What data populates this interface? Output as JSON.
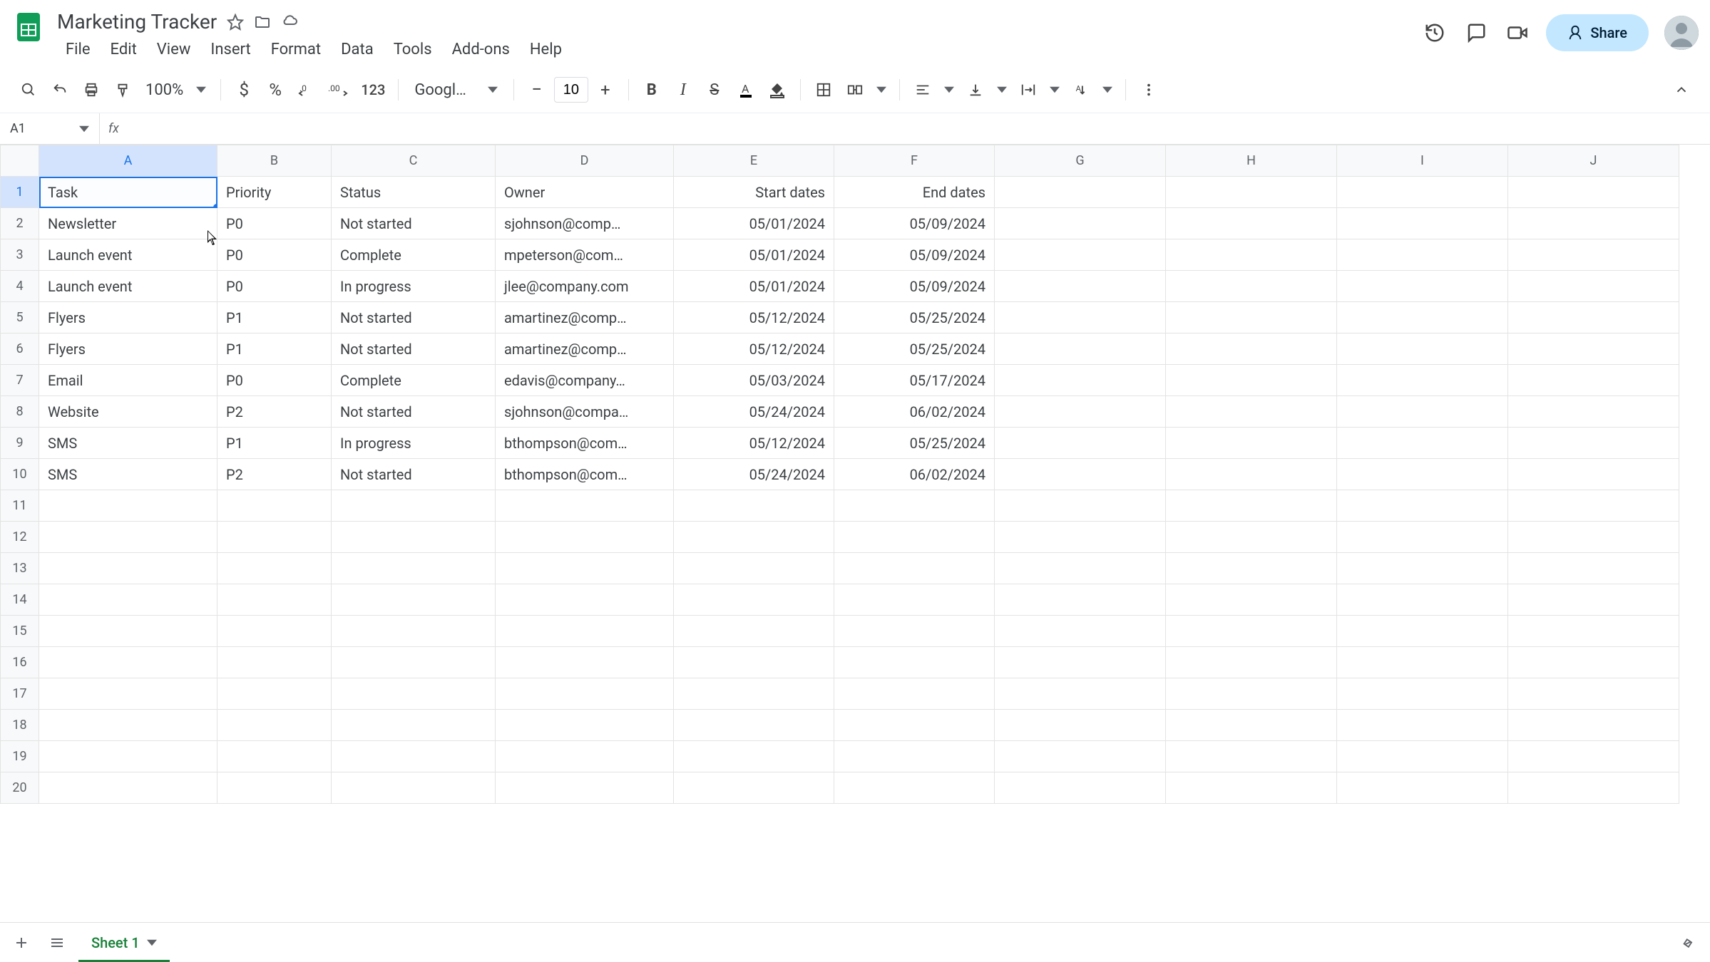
{
  "doc": {
    "title": "Marketing Tracker"
  },
  "menubar": [
    "File",
    "Edit",
    "View",
    "Insert",
    "Format",
    "Data",
    "Tools",
    "Add-ons",
    "Help"
  ],
  "toolbar": {
    "zoom": "100%",
    "font_family": "Googl…",
    "font_size": "10"
  },
  "share": {
    "label": "Share"
  },
  "namebox": {
    "ref": "A1"
  },
  "columns": [
    "A",
    "B",
    "C",
    "D",
    "E",
    "F",
    "G",
    "H",
    "I",
    "J"
  ],
  "headers": {
    "A": "Task",
    "B": "Priority",
    "C": "Status",
    "D": "Owner",
    "E": "Start dates",
    "F": "End dates"
  },
  "rows": [
    {
      "A": "Newsletter",
      "B": "P0",
      "C": "Not started",
      "D": "sjohnson@comp…",
      "E": "05/01/2024",
      "F": "05/09/2024"
    },
    {
      "A": "Launch event",
      "B": "P0",
      "C": "Complete",
      "D": "mpeterson@com…",
      "E": "05/01/2024",
      "F": "05/09/2024"
    },
    {
      "A": "Launch event",
      "B": "P0",
      "C": "In progress",
      "D": "jlee@company.com",
      "E": "05/01/2024",
      "F": "05/09/2024"
    },
    {
      "A": "Flyers",
      "B": "P1",
      "C": "Not started",
      "D": "amartinez@comp…",
      "E": "05/12/2024",
      "F": "05/25/2024"
    },
    {
      "A": "Flyers",
      "B": "P1",
      "C": "Not started",
      "D": "amartinez@comp…",
      "E": "05/12/2024",
      "F": "05/25/2024"
    },
    {
      "A": "Email",
      "B": "P0",
      "C": "Complete",
      "D": "edavis@company…",
      "E": "05/03/2024",
      "F": "05/17/2024"
    },
    {
      "A": "Website",
      "B": "P2",
      "C": "Not started",
      "D": "sjohnson@compa…",
      "E": "05/24/2024",
      "F": "06/02/2024"
    },
    {
      "A": "SMS",
      "B": "P1",
      "C": "In progress",
      "D": "bthompson@com…",
      "E": "05/12/2024",
      "F": "05/25/2024"
    },
    {
      "A": "SMS",
      "B": "P2",
      "C": "Not started",
      "D": "bthompson@com…",
      "E": "05/24/2024",
      "F": "06/02/2024"
    }
  ],
  "blank_rows": 10,
  "selected": {
    "col": "A",
    "row": 1
  },
  "sheet_tab": {
    "name": "Sheet 1"
  }
}
